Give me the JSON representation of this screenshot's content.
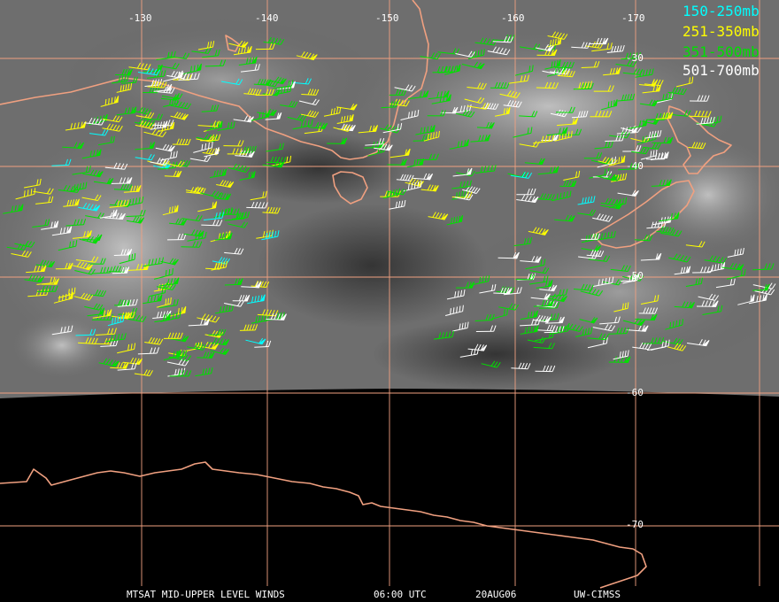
{
  "map": {
    "longitude_labels": [
      "-130",
      "-140",
      "-150",
      "-160",
      "-170"
    ],
    "latitude_labels": [
      "-30",
      "-40",
      "-50",
      "-60",
      "-70"
    ],
    "colors": {
      "grid": "#f0a080",
      "coastline": "#f0a080",
      "background": "#000000",
      "label": "#ffffff"
    }
  },
  "legend": [
    {
      "label": "150-250mb",
      "color": "#00ffff"
    },
    {
      "label": "251-350mb",
      "color": "#ffff00"
    },
    {
      "label": "351-500mb",
      "color": "#00e000"
    },
    {
      "label": "501-700mb",
      "color": "#ffffff"
    }
  ],
  "footer": {
    "product": "MTSAT MID-UPPER LEVEL WINDS",
    "time": "06:00 UTC",
    "date": "20AUG06",
    "source": "UW-CIMSS"
  }
}
